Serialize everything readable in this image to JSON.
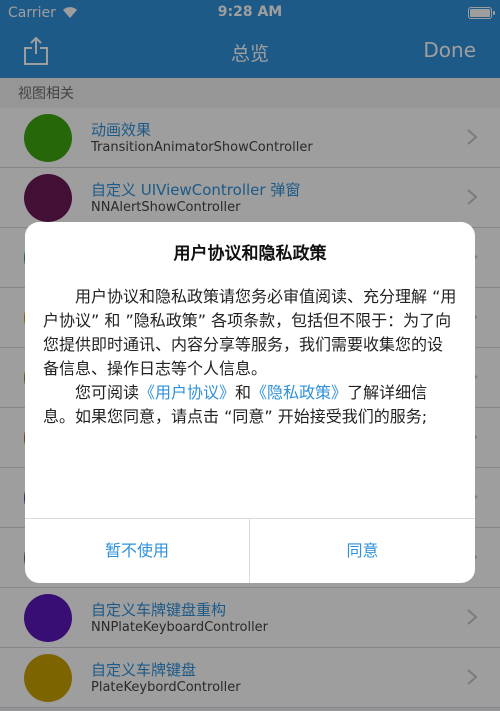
{
  "status_bar": {
    "carrier": "Carrier",
    "time": "9:28 AM"
  },
  "nav": {
    "title": "总览",
    "done_label": "Done",
    "share_icon": "share-icon"
  },
  "section": {
    "header": "视图相关"
  },
  "list": [
    {
      "title": "动画效果",
      "subtitle": "TransitionAnimatorShowController",
      "color": "#3ea70f"
    },
    {
      "title": "自定义 UIViewController 弹窗",
      "subtitle": "NNAlertShowController",
      "color": "#6a1a55"
    },
    {
      "title": "",
      "subtitle": "",
      "color": "#2f9e8c"
    },
    {
      "title": "",
      "subtitle": "",
      "color": "#c99a16"
    },
    {
      "title": "",
      "subtitle": "",
      "color": "#7d9a1e"
    },
    {
      "title": "",
      "subtitle": "",
      "color": "#b06a1b"
    },
    {
      "title": "",
      "subtitle": "",
      "color": "#6b3a7a"
    },
    {
      "title": "",
      "subtitle": "",
      "color": "#6a6a6a"
    },
    {
      "title": "自定义车牌键盘重构",
      "subtitle": "NNPlateKeyboardController",
      "color": "#5b17bd"
    },
    {
      "title": "自定义车牌键盘",
      "subtitle": "PlateKeybordController",
      "color": "#c8a200"
    }
  ],
  "dialog": {
    "title": "用户协议和隐私政策",
    "para1": "用户协议和隐私政策请您务必审值阅读、充分理解 “用户协议” 和 ”隐私政策” 各项条款，包括但不限于：为了向您提供即时通讯、内容分享等服务，我们需要收集您的设备信息、操作日志等个人信息。",
    "para2_prefix": "您可阅读",
    "link_user_agreement": "《用户协议》",
    "para2_and": "和",
    "link_privacy_policy": "《隐私政策》",
    "para2_suffix": "了解详细信息。如果您同意，请点击 “同意” 开始接受我们的服务;",
    "cancel_label": "暂不使用",
    "agree_label": "同意"
  }
}
